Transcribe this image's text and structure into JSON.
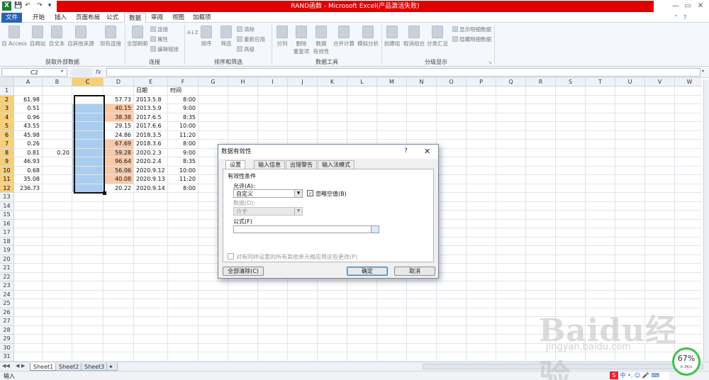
{
  "window": {
    "title": "RAND函数 - Microsoft Excel(产品激活失败)",
    "controls": [
      "?",
      "—",
      "▭",
      "✕"
    ]
  },
  "quick_access": {
    "logo": "X",
    "save": "💾",
    "undo": "↶",
    "redo": "↷",
    "more": "▾"
  },
  "menu": {
    "tabs": [
      "文件",
      "开始",
      "插入",
      "页面布局",
      "公式",
      "数据",
      "审阅",
      "视图",
      "加载项"
    ],
    "active": "数据"
  },
  "ribbon": {
    "get_external": {
      "label": "获取外部数据",
      "buttons": [
        "自 Access",
        "自网站",
        "自文本",
        "自其他来源",
        "现有连接"
      ]
    },
    "connections": {
      "label": "连接",
      "big": "全部刷新",
      "small": [
        "连接",
        "属性",
        "编辑链接"
      ]
    },
    "sort_filter": {
      "label": "排序和筛选",
      "sort_az": "A↓Z",
      "sort": "排序",
      "filter": "筛选",
      "small": [
        "清除",
        "重新应用",
        "高级"
      ]
    },
    "data_tools": {
      "label": "数据工具",
      "buttons": [
        "分列",
        "删除\n重复项",
        "数据\n有效性",
        "合并计算",
        "模拟分析"
      ]
    },
    "outline": {
      "label": "分级显示",
      "buttons": [
        "创建组",
        "取消组合",
        "分类汇总"
      ],
      "small": [
        "显示明细数据",
        "隐藏明细数据"
      ]
    }
  },
  "formula_bar": {
    "name_box": "C2",
    "fx": "fx",
    "value": ""
  },
  "grid": {
    "columns": [
      "A",
      "B",
      "C",
      "D",
      "E",
      "F",
      "G",
      "H",
      "I",
      "J",
      "K",
      "L",
      "M",
      "N",
      "O",
      "P",
      "Q",
      "R",
      "S",
      "T",
      "U",
      "V",
      "W"
    ],
    "row_count": 31,
    "selected_column": "C",
    "selected_rows_from": 2,
    "selected_rows_to": 12,
    "header_row": {
      "E": "日期",
      "F": "时间"
    },
    "col_a": [
      "61.98",
      "0.51",
      "0.96",
      "43.55",
      "45.98",
      "0.26",
      "0.81",
      "46.93",
      "0.68",
      "35.08",
      "236.73"
    ],
    "col_b_row8": "0.20",
    "col_d": [
      "57.73",
      "40.15",
      "38.38",
      "29.15",
      "24.86",
      "67.69",
      "59.28",
      "96.64",
      "56.06",
      "40.08",
      "20.22"
    ],
    "col_d_highlight": [
      false,
      true,
      true,
      false,
      false,
      true,
      true,
      true,
      true,
      true,
      false
    ],
    "col_e": [
      "2013.5.8",
      "2013.5.9",
      "2017.6.5",
      "2017.6.6",
      "2018.3.5",
      "2018.3.6",
      "2020.2.3",
      "2020.2.4",
      "2020.9.12",
      "2020.9.13",
      "2020.9.14"
    ],
    "col_f": [
      "8:00",
      "9:00",
      "8:35",
      "10:00",
      "11:20",
      "8:00",
      "9:00",
      "8:35",
      "10:00",
      "11:20",
      "8:00"
    ],
    "highlight_color": "#f8c9a7",
    "selection_color": "#a9cdee"
  },
  "sheets": {
    "tabs": [
      "Sheet1",
      "Sheet2",
      "Sheet3"
    ],
    "active": "Sheet1"
  },
  "status": {
    "mode": "输入"
  },
  "dialog": {
    "title": "数据有效性",
    "help": "?",
    "close": "✕",
    "tabs": [
      "设置",
      "输入信息",
      "出错警告",
      "输入法模式"
    ],
    "active_tab": "设置",
    "section": "有效性条件",
    "allow_label": "允许(A):",
    "allow_value": "自定义",
    "ignore_blank": "忽略空值(B)",
    "ignore_blank_checked": true,
    "data_label": "数据(D):",
    "data_value": "介于",
    "formula_label": "公式(F)",
    "formula_value": "",
    "apply_all": "对有同样设置的所有其他单元格应用这些更改(P)",
    "clear_all": "全部清除(C)",
    "ok": "确定",
    "cancel": "取消"
  },
  "watermark": {
    "brand": "Baidu经验",
    "url": "jingyan.baidu.com"
  },
  "tray": {
    "speed_percent": "67%",
    "speed_rate": "0.3K/s"
  }
}
